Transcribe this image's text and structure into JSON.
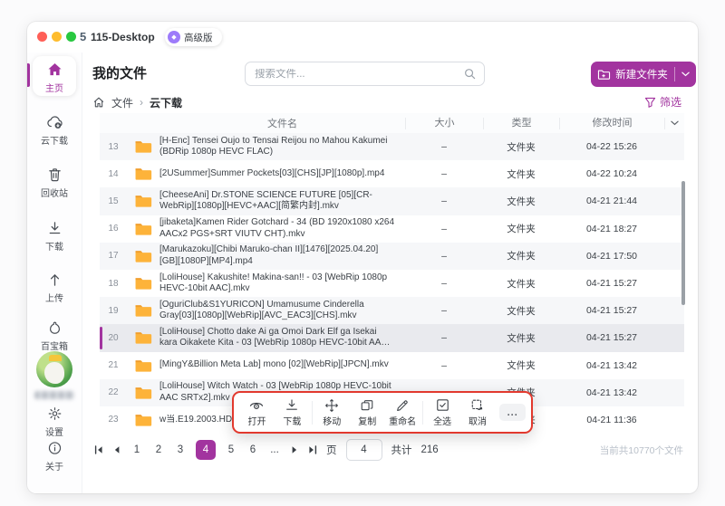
{
  "window": {
    "logo": "5",
    "title": "115-Desktop",
    "badge": "高级版"
  },
  "sidebar": {
    "items": [
      {
        "label": "主页",
        "icon": "home",
        "active": true
      },
      {
        "label": "云下载",
        "icon": "cloud-download"
      },
      {
        "label": "回收站",
        "icon": "trash"
      },
      {
        "label": "下载",
        "icon": "download"
      },
      {
        "label": "上传",
        "icon": "upload"
      },
      {
        "label": "百宝箱",
        "icon": "treasure"
      }
    ],
    "settings": "设置",
    "about": "关于"
  },
  "header": {
    "title": "我的文件",
    "search_placeholder": "搜索文件...",
    "new_folder": "新建文件夹"
  },
  "breadcrumb": {
    "root": "文件",
    "separator": "›",
    "current": "云下载",
    "filter": "筛选"
  },
  "table": {
    "headers": {
      "name": "文件名",
      "size": "大小",
      "type": "类型",
      "modified": "修改时间"
    },
    "rows": [
      {
        "no": "13",
        "name": "[H-Enc] Tensei Oujo to Tensai Reijou no Mahou Kakumei (BDRip 1080p HEVC FLAC)",
        "size": "–",
        "type": "文件夹",
        "modified": "04-22 15:26",
        "shade": "gray"
      },
      {
        "no": "14",
        "name": "[2USummer]Summer Pockets[03][CHS][JP][1080p].mp4",
        "size": "–",
        "type": "文件夹",
        "modified": "04-22 10:24",
        "shade": "white"
      },
      {
        "no": "15",
        "name": "[CheeseAni] Dr.STONE SCIENCE FUTURE [05][CR-WebRip][1080p][HEVC+AAC][简繁内封].mkv",
        "size": "–",
        "type": "文件夹",
        "modified": "04-21 21:44",
        "shade": "gray"
      },
      {
        "no": "16",
        "name": "[jibaketa]Kamen Rider Gotchard - 34 (BD 1920x1080 x264 AACx2 PGS+SRT VIUTV CHT).mkv",
        "size": "–",
        "type": "文件夹",
        "modified": "04-21 18:27",
        "shade": "white"
      },
      {
        "no": "17",
        "name": "[Marukazoku][Chibi Maruko-chan II][1476][2025.04.20][GB][1080P][MP4].mp4",
        "size": "–",
        "type": "文件夹",
        "modified": "04-21 17:50",
        "shade": "gray"
      },
      {
        "no": "18",
        "name": "[LoliHouse] Kakushite! Makina-san!! - 03 [WebRip 1080p HEVC-10bit AAC].mkv",
        "size": "–",
        "type": "文件夹",
        "modified": "04-21 15:27",
        "shade": "white"
      },
      {
        "no": "19",
        "name": "[OguriClub&S1YURICON] Umamusume Cinderella Gray[03][1080p][WebRip][AVC_EAC3][CHS].mkv",
        "size": "–",
        "type": "文件夹",
        "modified": "04-21 15:27",
        "shade": "gray"
      },
      {
        "no": "20",
        "name": "[LoliHouse] Chotto dake Ai ga Omoi Dark Elf ga Isekai kara Oikakete Kita - 03 [WebRip 1080p HEVC-10bit AAC ...",
        "size": "–",
        "type": "文件夹",
        "modified": "04-21 15:27",
        "shade": "selected"
      },
      {
        "no": "21",
        "name": "[MingY&Billion Meta Lab] mono [02][WebRip][JPCN].mkv",
        "size": "–",
        "type": "文件夹",
        "modified": "04-21 13:42",
        "shade": "white"
      },
      {
        "no": "22",
        "name": "[LoliHouse] Witch Watch - 03 [WebRip 1080p HEVC-10bit AAC SRTx2].mkv",
        "size": "–",
        "type": "文件夹",
        "modified": "04-21 13:42",
        "shade": "gray"
      },
      {
        "no": "23",
        "name": "w当.E19.2003.HD1080p.mp4",
        "size": "–",
        "type": "文件夹",
        "modified": "04-21 11:36",
        "shade": "white"
      }
    ]
  },
  "toolbar": {
    "items": [
      {
        "label": "打开",
        "icon": "preview-eye"
      },
      {
        "label": "下载",
        "icon": "download"
      },
      {
        "label": "移动",
        "icon": "move"
      },
      {
        "label": "复制",
        "icon": "copy"
      },
      {
        "label": "重命名",
        "icon": "rename"
      },
      {
        "label": "全选",
        "icon": "select-all"
      },
      {
        "label": "取消",
        "icon": "deselect"
      }
    ],
    "more_label": "..."
  },
  "pagination": {
    "pages": [
      "1",
      "2",
      "3",
      "4",
      "5",
      "6"
    ],
    "active_page": "4",
    "ellipsis": "...",
    "jump_label": "页",
    "jump_value": "4",
    "total_label": "共计",
    "total_pages": "216"
  },
  "footer": {
    "summary": "当前共10770个文件"
  },
  "colors": {
    "accent": "#a2349f",
    "highlight_border": "#e2392e",
    "folder": "#fdb33a"
  }
}
